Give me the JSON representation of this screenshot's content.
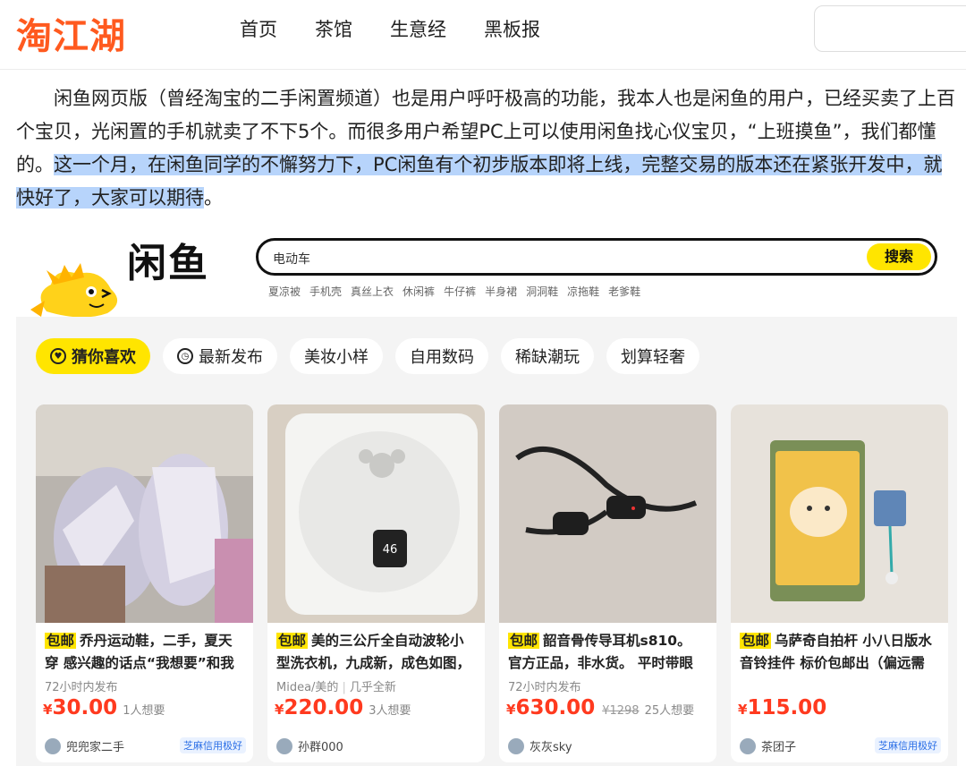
{
  "site": {
    "logo": "淘江湖",
    "nav": [
      "首页",
      "茶馆",
      "生意经",
      "黑板报"
    ]
  },
  "article": {
    "text_plain": "闲鱼网页版（曾经淘宝的二手闲置频道）也是用户呼吁极高的功能，我本人也是闲鱼的用户，已经买卖了上百个宝贝，光闲置的手机就卖了不下5个。而很多用户希望PC上可以使用闲鱼找心仪宝贝，“上班摸鱼”，我们都懂的。",
    "text_highlight": "这一个月，在闲鱼同学的不懈努力下，PC闲鱼有个初步版本即将上线，完整交易的版本还在紧张开发中，就快好了，大家可以期待",
    "text_end": "。"
  },
  "xianyu": {
    "logo": "闲鱼",
    "search_query": "电动车",
    "search_button": "搜索",
    "hot_words": [
      "夏凉被",
      "手机壳",
      "真丝上衣",
      "休闲裤",
      "牛仔裤",
      "半身裙",
      "洞洞鞋",
      "凉拖鞋",
      "老爹鞋"
    ],
    "tabs": [
      "猜你喜欢",
      "最新发布",
      "美妆小样",
      "自用数码",
      "稀缺潮玩",
      "划算轻奢"
    ],
    "cards": [
      {
        "tag": "包邮",
        "title": "乔丹运动鞋，二手，夏天穿 感兴趣的话点“我想要”和我",
        "meta": "72小时内发布",
        "meta2": "",
        "price": "30.00",
        "orig": "",
        "want": "1人想要",
        "seller": "兜兜家二手",
        "credit": "芝麻信用极好"
      },
      {
        "tag": "包邮",
        "title": "美的三公斤全自动波轮小型洗衣机，九成新，成色如图，",
        "meta": "Midea/美的",
        "meta2": "几乎全新",
        "price": "220.00",
        "orig": "",
        "want": "3人想要",
        "seller": "孙群000",
        "credit": ""
      },
      {
        "tag": "包邮",
        "title": "韶音骨传导耳机s810。 官方正品，非水货。 平时带眼",
        "meta": "72小时内发布",
        "meta2": "",
        "price": "630.00",
        "orig": "¥1298",
        "want": "25人想要",
        "seller": "灰灰sky",
        "credit": ""
      },
      {
        "tag": "包邮",
        "title": "乌萨奇自拍杆 小八日版水音铃挂件 标价包邮出（偏远需",
        "meta": "",
        "meta2": "",
        "price": "115.00",
        "orig": "",
        "want": "",
        "seller": "茶团子",
        "credit": "芝麻信用极好"
      }
    ],
    "currency": "¥"
  }
}
